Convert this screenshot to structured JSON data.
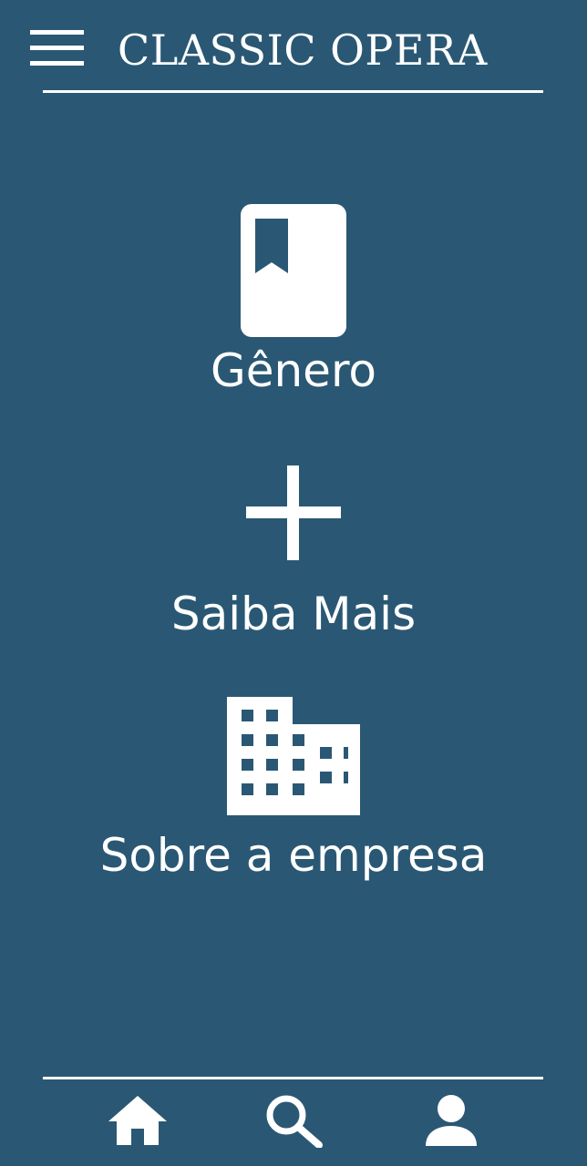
{
  "header": {
    "menu_icon": "hamburger-menu-icon",
    "title": "CLASSIC OPERA"
  },
  "menu": {
    "items": [
      {
        "label": "Gênero",
        "icon": "bookmark-book-icon"
      },
      {
        "label": "Saiba Mais",
        "icon": "plus-icon"
      },
      {
        "label": "Sobre a empresa",
        "icon": "building-icon"
      }
    ]
  },
  "bottom_nav": {
    "items": [
      {
        "icon": "home-icon"
      },
      {
        "icon": "search-icon"
      },
      {
        "icon": "user-icon"
      }
    ]
  },
  "colors": {
    "background": "#2a5874",
    "foreground": "#ffffff"
  }
}
